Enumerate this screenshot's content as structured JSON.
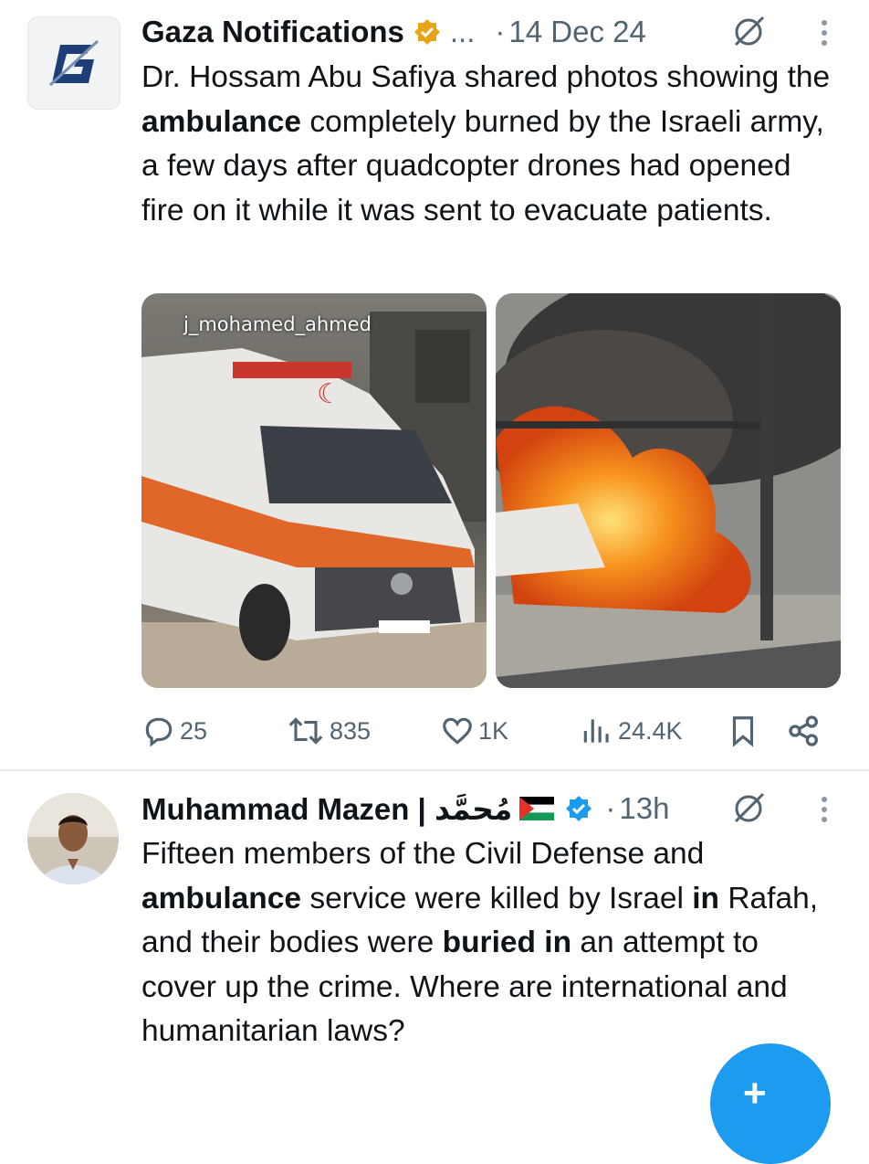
{
  "tweet1": {
    "display_name": "Gaza Notifications",
    "truncation": "...",
    "separator": "·",
    "date": "14 Dec 24",
    "verified_color": "#e8a317",
    "body_parts": [
      "Dr. Hossam Abu Safiya shared photos showing the ",
      "ambulance",
      " completely burned by the Israeli army, a few days after quadcopter drones had opened fire on it while it was sent to evacuate patients."
    ],
    "image_left_watermark": "j_mohamed_ahmed",
    "image_left_desc_icon": "ambulance-photo",
    "image_right_desc_icon": "burning-vehicle-photo",
    "actions": {
      "replies": "25",
      "reposts": "835",
      "likes": "1K",
      "views": "24.4K"
    }
  },
  "tweet2": {
    "display_name": "Muhammad Mazen | مُحمَّد",
    "separator": "·",
    "time": "13h",
    "verified_color": "#1d9bf0",
    "body_parts": [
      "Fifteen members of the Civil Defense and ",
      "ambulance",
      " service were killed by Israel ",
      "in",
      " Rafah, and their bodies were ",
      "buried in",
      " an attempt to cover up the crime. Where are international and humanitarian laws?"
    ]
  },
  "fab": {
    "label": "+",
    "icon": "compose-icon"
  },
  "colors": {
    "accent": "#1d9bf0",
    "muted": "#536471",
    "text": "#0f1419"
  }
}
